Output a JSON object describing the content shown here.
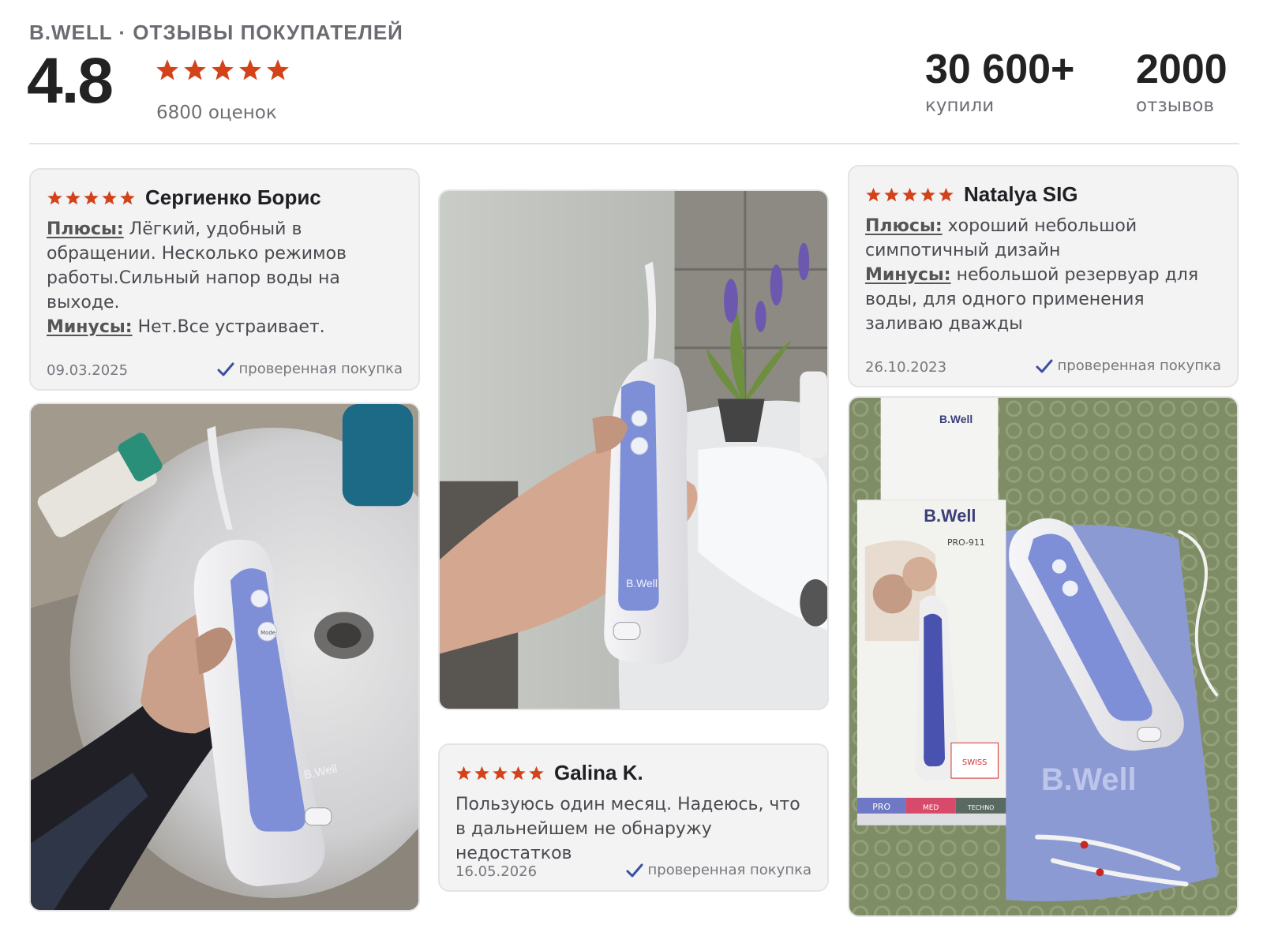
{
  "header": {
    "brand_title": "B.WELL · ОТЗЫВЫ ПОКУПАТЕЛЕЙ",
    "rating": "4.8",
    "rating_count": "6800 оценок",
    "stars": 5
  },
  "stats": {
    "bought_value": "30 600+",
    "bought_label": "купили",
    "reviews_value": "2000",
    "reviews_label": "отзывов"
  },
  "reviews": [
    {
      "author": "Сергиенко Борис",
      "stars": 5,
      "pros_label": "Плюсы:",
      "pros": "Лёгкий, удобный в обращении. Несколько режимов работы.Сильный напор воды на выходе.",
      "cons_label": "Минусы:",
      "cons": "Нет.Все устраивает.",
      "date": "09.03.2025",
      "verified": "проверенная покупка"
    },
    {
      "author": "Galina K.",
      "stars": 5,
      "text": "Пользуюсь один месяц. Надеюсь, что в дальнейшем не обнаружу недостатков",
      "date": "16.05.2026",
      "verified": "проверенная покупка"
    },
    {
      "author": "Natalya SIG",
      "stars": 5,
      "pros_label": "Плюсы:",
      "pros": "хороший небольшой симпотичный дизайн",
      "cons_label": "Минусы:",
      "cons": "небольшой резервуар для воды, для одного применения заливаю дважды",
      "date": "26.10.2023",
      "verified": "проверенная покупка"
    }
  ],
  "photos": {
    "device_brand": "B.Well",
    "mode_label": "Mode",
    "box_brand": "B.Well",
    "box_model": "PRO-911",
    "box_pro": "PRO",
    "box_med": "MED",
    "box_techno": "TECHNO",
    "swiss_label": "SWISS",
    "bag_brand": "B.Well"
  },
  "colors": {
    "star": "#d4421a",
    "verified_check": "#3a4fa3",
    "device_blue": "#7e8fd8"
  }
}
